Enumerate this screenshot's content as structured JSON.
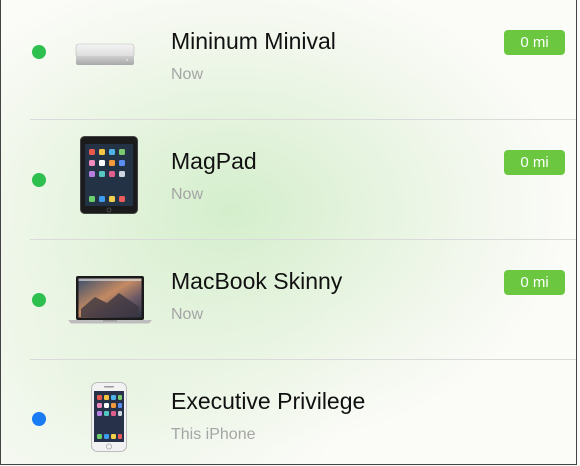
{
  "colors": {
    "online": "#2ec04f",
    "this_device": "#1a7cf5",
    "badge": "#6ac73f"
  },
  "devices": [
    {
      "name": "Mininum Minival",
      "status": "Now",
      "distance": "0 mi",
      "icon": "mac-mini-icon"
    },
    {
      "name": "MagPad",
      "status": "Now",
      "distance": "0 mi",
      "icon": "ipad-icon"
    },
    {
      "name": "MacBook Skinny",
      "status": "Now",
      "distance": "0 mi",
      "icon": "macbook-icon"
    },
    {
      "name": "Executive Privilege",
      "status": "This iPhone",
      "icon": "iphone-icon"
    }
  ]
}
